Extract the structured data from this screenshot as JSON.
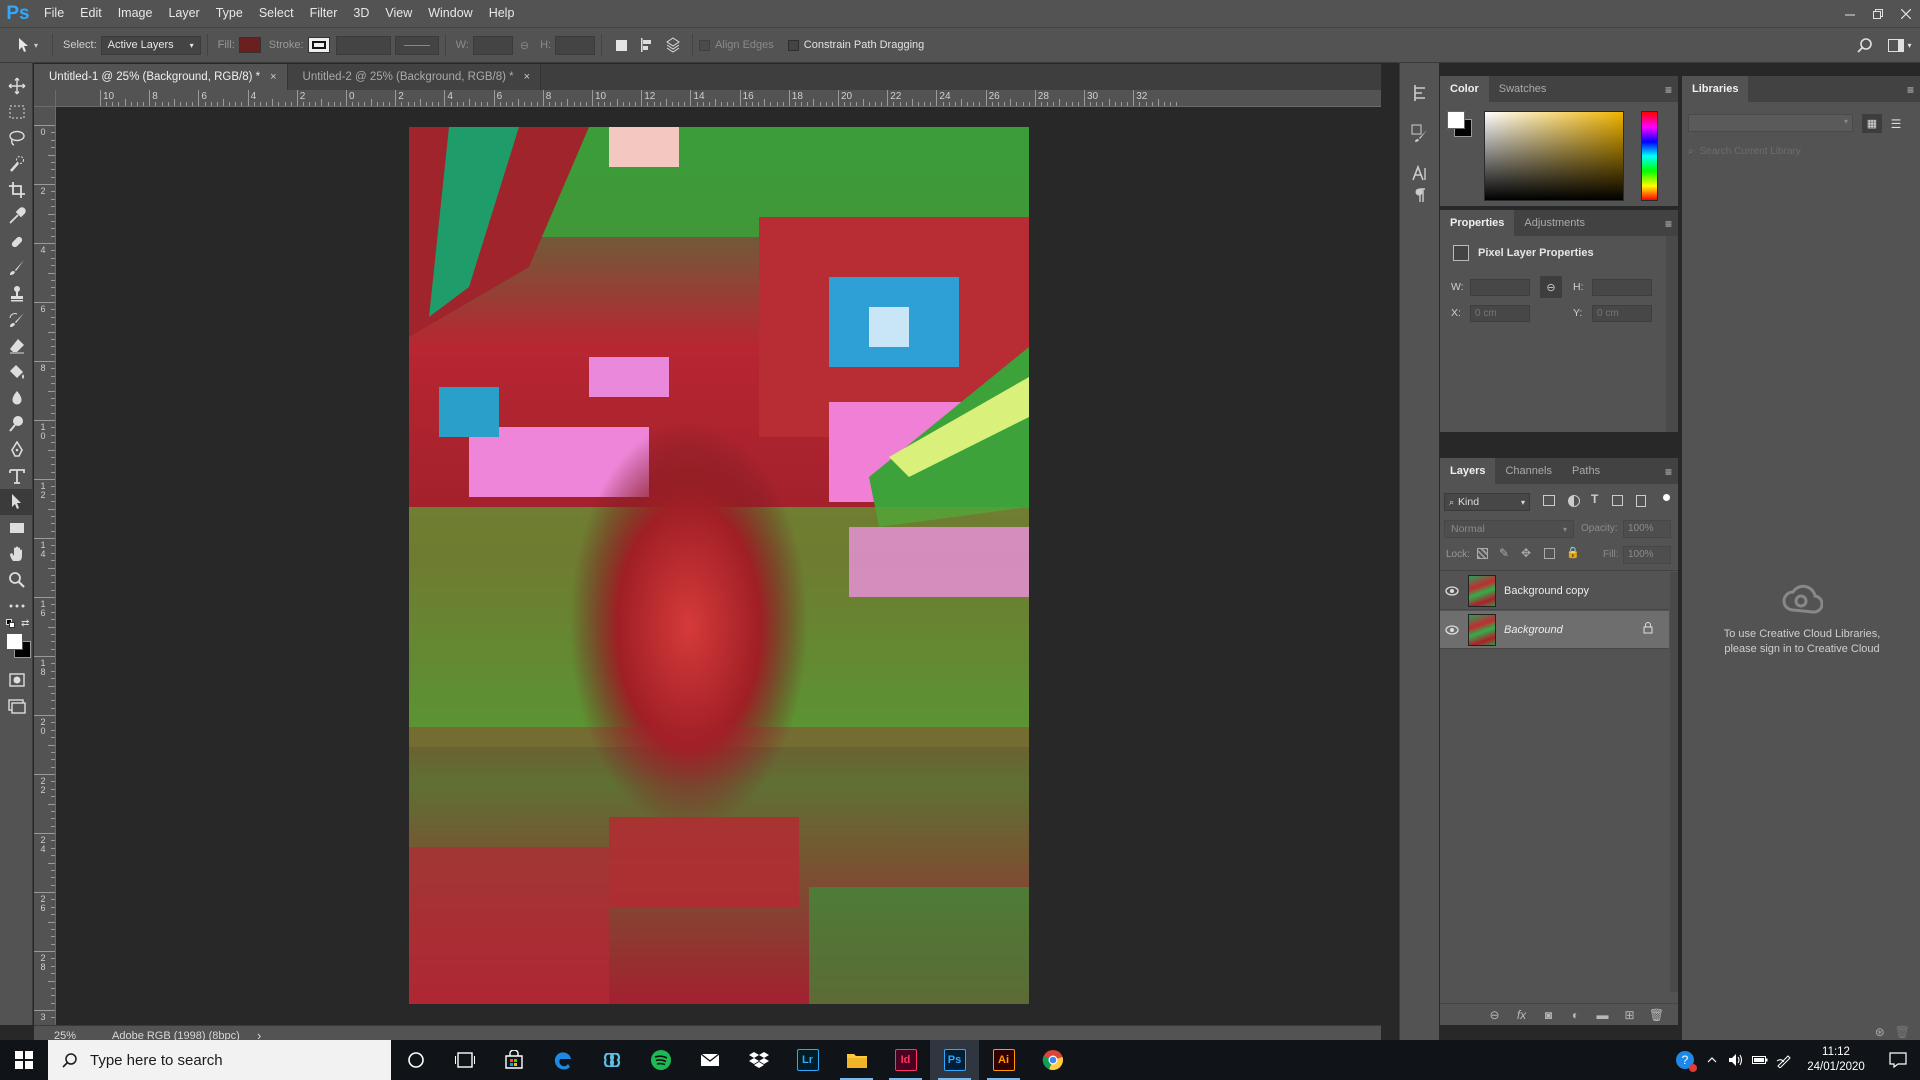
{
  "app": {
    "logo": "Ps",
    "menu": [
      "File",
      "Edit",
      "Image",
      "Layer",
      "Type",
      "Select",
      "Filter",
      "3D",
      "View",
      "Window",
      "Help"
    ]
  },
  "options_bar": {
    "select_label": "Select:",
    "select_value": "Active Layers",
    "fill_label": "Fill:",
    "fill_color": "#6b2020",
    "stroke_label": "Stroke:",
    "w_label": "W:",
    "h_label": "H:",
    "align_edges_label": "Align Edges",
    "constrain_label": "Constrain Path Dragging"
  },
  "documents": {
    "tabs": [
      {
        "label": "Untitled-1 @ 25% (Background, RGB/8) *",
        "close": "×"
      },
      {
        "label": "Untitled-2 @ 25% (Background, RGB/8) *",
        "close": "×"
      }
    ]
  },
  "rulers": {
    "h_labels": [
      "10",
      "8",
      "6",
      "4",
      "2",
      "0",
      "2",
      "4",
      "6",
      "8",
      "10",
      "12",
      "14",
      "16",
      "18",
      "20",
      "22",
      "24",
      "26",
      "28",
      "30",
      "32"
    ],
    "v_labels": [
      "0",
      "2",
      "4",
      "6",
      "8",
      "10",
      "12",
      "14",
      "16",
      "18",
      "20",
      "22",
      "24",
      "26",
      "28",
      "3"
    ]
  },
  "status": {
    "zoom": "25%",
    "profile": "Adobe RGB (1998) (8bpc)",
    "arrow": "›"
  },
  "color_panel": {
    "tabs": [
      "Color",
      "Swatches"
    ],
    "foreground": "#ffffff",
    "background": "#000000"
  },
  "libraries_panel": {
    "title": "Libraries",
    "search_placeholder": "Search Current Library",
    "message": "To use Creative Cloud Libraries, please sign in to Creative Cloud"
  },
  "properties_panel": {
    "tabs": [
      "Properties",
      "Adjustments"
    ],
    "heading": "Pixel Layer Properties",
    "w_label": "W:",
    "h_label": "H:",
    "x_label": "X:",
    "y_label": "Y:",
    "x_value": "0 cm",
    "y_value": "0 cm"
  },
  "layers_panel": {
    "tabs": [
      "Layers",
      "Channels",
      "Paths"
    ],
    "filter_kind": "Kind",
    "blend_mode": "Normal",
    "opacity_label": "Opacity:",
    "opacity_value": "100%",
    "lock_label": "Lock:",
    "fill_label": "Fill:",
    "fill_value": "100%",
    "layers": [
      {
        "name": "Background copy",
        "visible": true,
        "selected": false,
        "locked": false
      },
      {
        "name": "Background",
        "visible": true,
        "selected": true,
        "locked": true
      }
    ]
  },
  "taskbar": {
    "search_placeholder": "Type here to search",
    "time": "11:12",
    "date": "24/01/2020",
    "apps": [
      {
        "icon": "cortana-icon"
      },
      {
        "icon": "task-view-icon"
      },
      {
        "icon": "store-icon"
      },
      {
        "icon": "edge-icon"
      },
      {
        "icon": "infinity-icon"
      },
      {
        "icon": "spotify-icon"
      },
      {
        "icon": "mail-icon"
      },
      {
        "icon": "dropbox-icon"
      },
      {
        "icon": "lightroom-icon",
        "label": "Lr"
      },
      {
        "icon": "file-explorer-icon"
      },
      {
        "icon": "indesign-icon",
        "label": "Id"
      },
      {
        "icon": "photoshop-icon",
        "label": "Ps"
      },
      {
        "icon": "illustrator-icon",
        "label": "Ai"
      },
      {
        "icon": "chrome-icon"
      }
    ]
  }
}
